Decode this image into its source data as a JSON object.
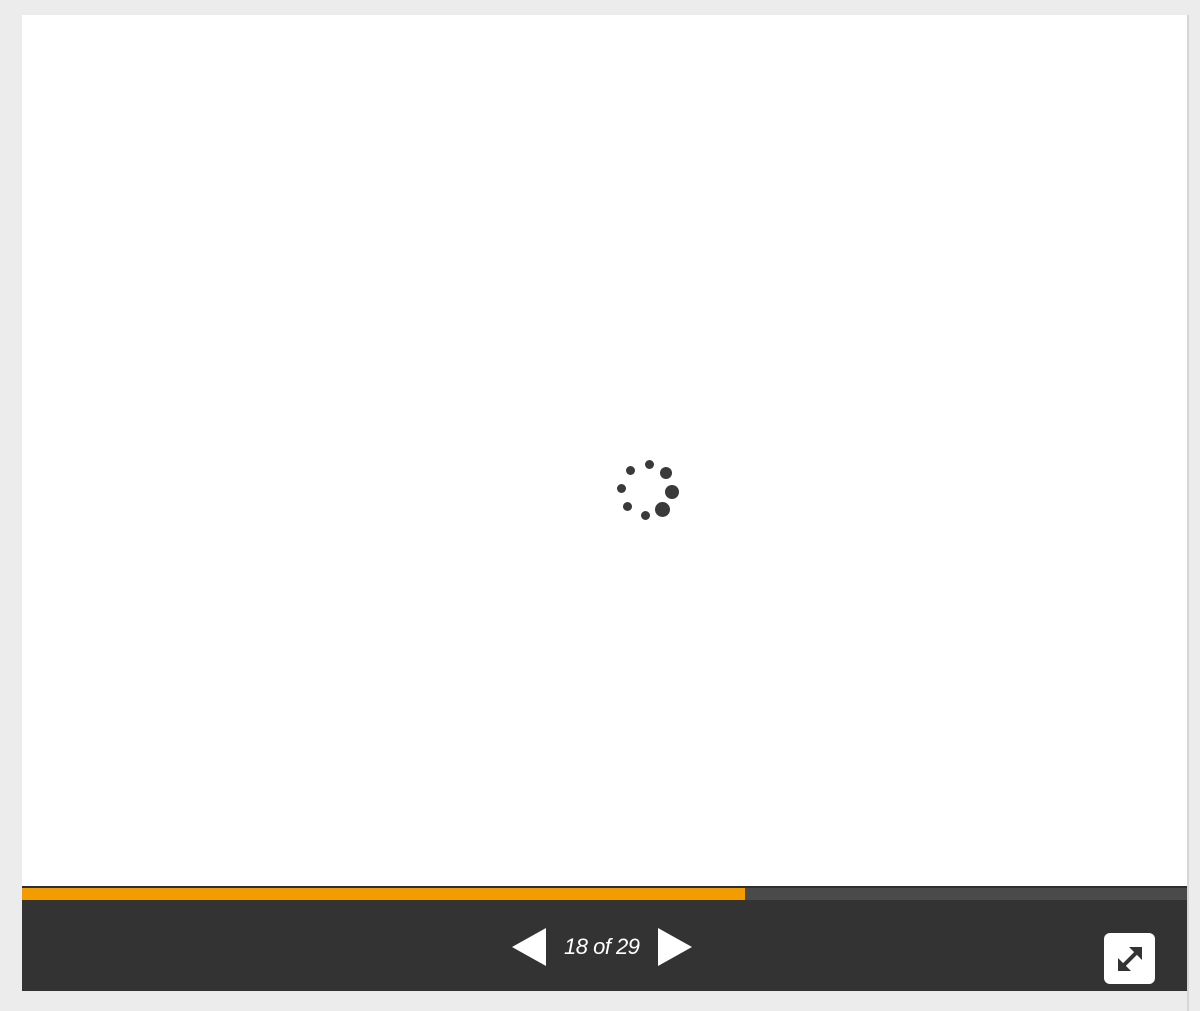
{
  "slideshow": {
    "counter": {
      "current": 18,
      "total": 29,
      "text": "18 of 29"
    },
    "progress_fraction": 0.6207,
    "colors": {
      "progress": "#f39c00",
      "track": "#4a4a4a",
      "bar": "#333333",
      "spinner": "#3a3a3a"
    },
    "icons": {
      "loading": "loading-spinner-icon",
      "previous": "triangle-left-icon",
      "next": "triangle-right-icon",
      "fullscreen": "expand-arrows-icon"
    }
  }
}
